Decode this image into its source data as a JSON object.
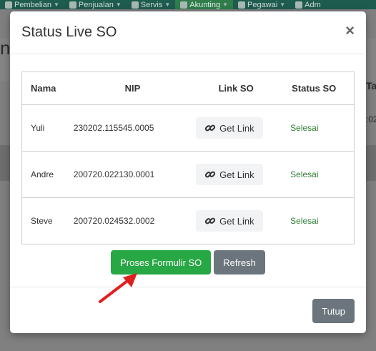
{
  "topnav": {
    "items": [
      {
        "label": "Pembelian",
        "icon": "cart-icon"
      },
      {
        "label": "Penjualan",
        "icon": "document-icon"
      },
      {
        "label": "Servis",
        "icon": "gears-icon"
      },
      {
        "label": "Akunting",
        "icon": "money-icon",
        "active": true
      },
      {
        "label": "Pegawai",
        "icon": "id-card-icon"
      },
      {
        "label": "Adm",
        "icon": "gear-icon"
      }
    ]
  },
  "background": {
    "letter": "n",
    "col_t": "Ta",
    "val": ":02"
  },
  "modal": {
    "title": "Status Live SO",
    "close": "×",
    "table": {
      "headers": [
        "Nama",
        "NIP",
        "Link SO",
        "Status SO"
      ],
      "rows": [
        {
          "nama": "Yuli",
          "nip": "230202.115545.0005",
          "link": "Get Link",
          "status": "Selesai"
        },
        {
          "nama": "Andre",
          "nip": "200720.022130.0001",
          "link": "Get Link",
          "status": "Selesai"
        },
        {
          "nama": "Steve",
          "nip": "200720.024532.0002",
          "link": "Get Link",
          "status": "Selesai"
        }
      ]
    },
    "buttons": {
      "proses": "Proses Formulir SO",
      "refresh": "Refresh",
      "tutup": "Tutup"
    }
  },
  "colors": {
    "accent_green": "#28a745",
    "gray_button": "#6c757d",
    "status_green": "#2e7d32",
    "arrow_red": "#e02020"
  }
}
